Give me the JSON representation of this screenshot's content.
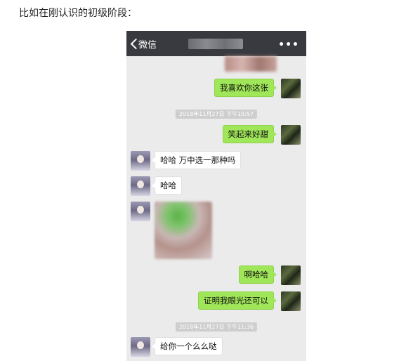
{
  "caption": "比如在刚认识的初级阶段：",
  "chat": {
    "navbar": {
      "back_label": "微信",
      "more": "•••"
    },
    "messages": [
      {
        "side": "self",
        "text": "我喜欢你这张"
      },
      {
        "type": "timestamp",
        "text": "2018年11月27日 下午10:57"
      },
      {
        "side": "self",
        "text": "笑起来好甜"
      },
      {
        "side": "other",
        "text": "哈哈 万中选一那种吗"
      },
      {
        "side": "other",
        "text": "哈哈"
      },
      {
        "side": "other",
        "type": "image"
      },
      {
        "side": "self",
        "text": "啊哈哈"
      },
      {
        "side": "self",
        "text": "证明我眼光还可以"
      },
      {
        "type": "timestamp",
        "text": "2018年11月27日 下午11:36"
      },
      {
        "side": "other",
        "text": "给你一个么么哒"
      }
    ]
  }
}
